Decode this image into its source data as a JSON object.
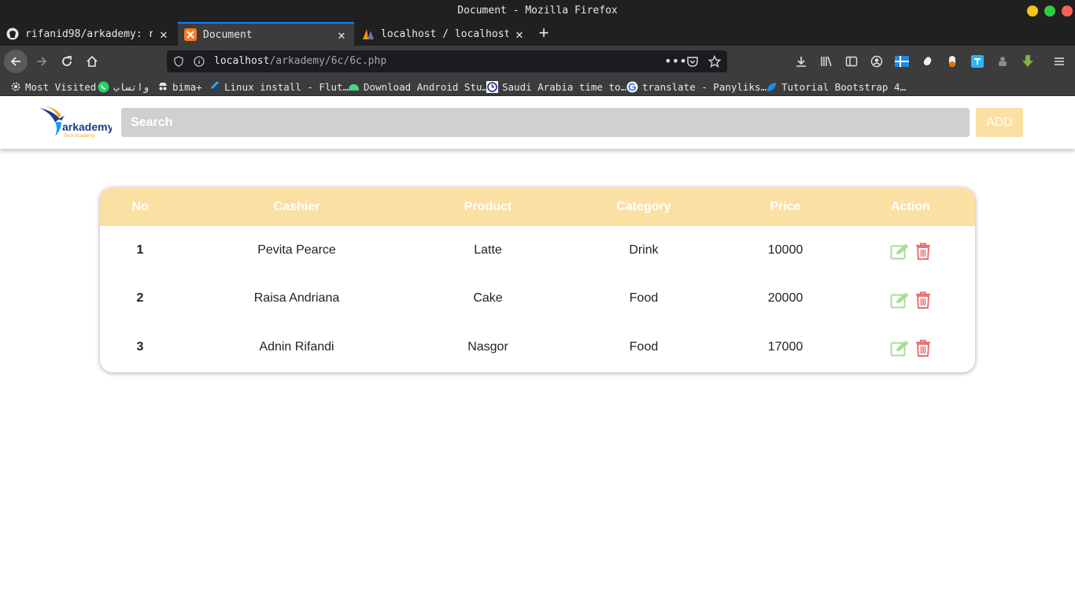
{
  "window": {
    "title": "Document - Mozilla Firefox"
  },
  "tabs": [
    {
      "label": "rifanid98/arkademy: repos",
      "active": false
    },
    {
      "label": "Document",
      "active": true
    },
    {
      "label": "localhost / localhost / p",
      "active": false
    }
  ],
  "address": {
    "host": "localhost",
    "path": "/arkademy/6c/6c.php"
  },
  "bookmarks": [
    "Most Visited",
    "واتساب",
    "bima+",
    "Linux install - Flut…",
    "Download Android Stu…",
    "Saudi Arabia time to…",
    "translate - Panyliks…",
    "Tutorial Bootstrap 4…"
  ],
  "app": {
    "logo_text": "arkademy",
    "logo_subtext": "Tech Academy",
    "search_placeholder": "Search",
    "add_label": "ADD"
  },
  "table": {
    "headers": [
      "No",
      "Cashier",
      "Product",
      "Category",
      "Price",
      "Action"
    ],
    "rows": [
      {
        "no": "1",
        "cashier": "Pevita Pearce",
        "product": "Latte",
        "category": "Drink",
        "price": "10000"
      },
      {
        "no": "2",
        "cashier": "Raisa Andriana",
        "product": "Cake",
        "category": "Food",
        "price": "20000"
      },
      {
        "no": "3",
        "cashier": "Adnin Rifandi",
        "product": "Nasgor",
        "category": "Food",
        "price": "17000"
      }
    ]
  },
  "colors": {
    "accent": "#fae0a3",
    "edit": "#a8dc9a",
    "delete": "#e57373"
  }
}
